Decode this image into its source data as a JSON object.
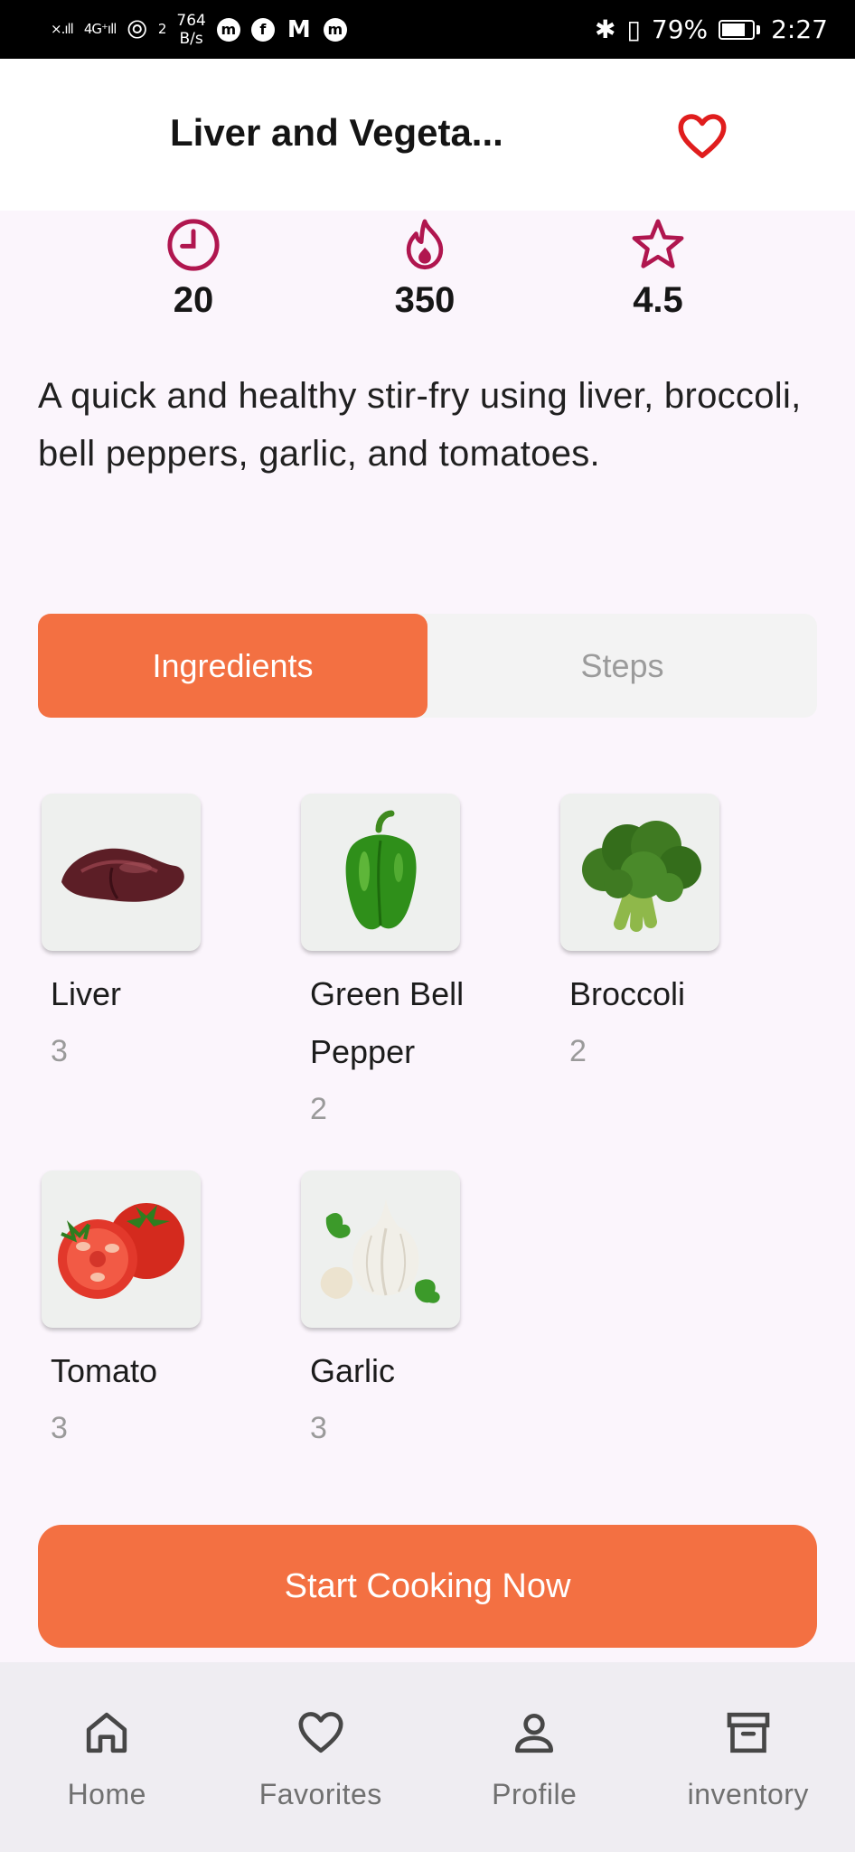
{
  "status_bar": {
    "signal_left": "×.ıll",
    "signal_4g": "4G⁺ıll",
    "hotspot_count": "2",
    "speed_value": "764",
    "speed_unit": "B/s",
    "battery_percent": "79%",
    "time": "2:27"
  },
  "header": {
    "title": "Liver and Vegeta..."
  },
  "stats": {
    "time": "20",
    "calories": "350",
    "rating": "4.5"
  },
  "description": "A quick and healthy stir-fry using liver, broccoli, bell peppers, garlic, and tomatoes.",
  "tabs": {
    "ingredients": "Ingredients",
    "steps": "Steps"
  },
  "ingredients": [
    {
      "name": "Liver",
      "qty": "3"
    },
    {
      "name": "Green Bell Pepper",
      "qty": "2"
    },
    {
      "name": "Broccoli",
      "qty": "2"
    },
    {
      "name": "Tomato",
      "qty": "3"
    },
    {
      "name": "Garlic",
      "qty": "3"
    }
  ],
  "cta_label": "Start Cooking Now",
  "nav": {
    "home": "Home",
    "favorites": "Favorites",
    "profile": "Profile",
    "inventory": "inventory"
  },
  "colors": {
    "accent": "#f37042",
    "icon_stats": "#b0164f",
    "favorite": "#e01d1d"
  }
}
